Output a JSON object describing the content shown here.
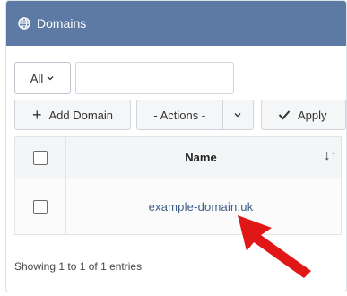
{
  "panel": {
    "title": "Domains",
    "icon": "globe-icon",
    "header_color": "#5c7aa3"
  },
  "toolbar": {
    "filter_label": "All",
    "search_value": "",
    "search_placeholder": "",
    "add_label": "Add Domain",
    "actions_label": "- Actions -",
    "apply_label": "Apply"
  },
  "table": {
    "columns": [
      "Name"
    ],
    "rows": [
      {
        "name": "example-domain.uk",
        "selected": false
      }
    ]
  },
  "footer": {
    "info": "Showing 1 to 1 of 1 entries"
  },
  "annotation": {
    "arrow_color": "#e11717",
    "icon": "red-arrow-icon"
  }
}
